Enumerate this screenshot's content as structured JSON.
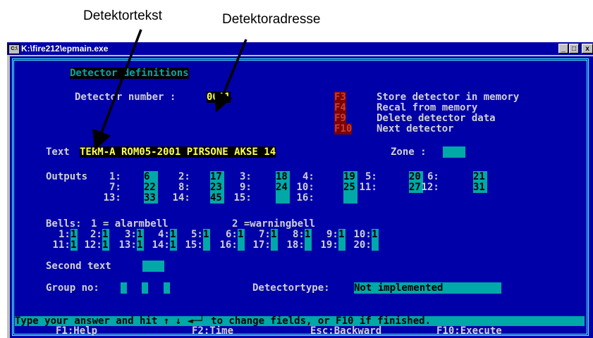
{
  "annotations": {
    "label_left": "Detektortekst",
    "label_right": "Detektoradresse"
  },
  "window": {
    "title": "K:\\fire212\\epmain.exe",
    "icon_text": "C:\\",
    "min_label": "_",
    "max_label": "□",
    "close_label": "x"
  },
  "header": {
    "title": "Detector definitions",
    "number_label": "Detector number :",
    "number_value": "0001"
  },
  "fkeys": [
    {
      "key": "F3",
      "label": "Store detector in memory"
    },
    {
      "key": "F4",
      "label": "Recal from memory"
    },
    {
      "key": "F9",
      "label": "Delete detector data"
    },
    {
      "key": "F10",
      "label": "Next detector"
    }
  ],
  "text_field": {
    "label": "Text",
    "value": "TERM-A ROM05-2001 PIRSONE AKSE 14",
    "zone_label": "Zone :",
    "zone_value": ""
  },
  "outputs": {
    "label": "Outputs",
    "items": [
      {
        "n": "1:",
        "v": "6"
      },
      {
        "n": "2:",
        "v": "17"
      },
      {
        "n": "3:",
        "v": "18"
      },
      {
        "n": "4:",
        "v": "19"
      },
      {
        "n": "5:",
        "v": "20"
      },
      {
        "n": "6:",
        "v": "21"
      },
      {
        "n": "7:",
        "v": "22"
      },
      {
        "n": "8:",
        "v": "23"
      },
      {
        "n": "9:",
        "v": "24"
      },
      {
        "n": "10:",
        "v": "25"
      },
      {
        "n": "11:",
        "v": "27"
      },
      {
        "n": "12:",
        "v": "31"
      },
      {
        "n": "13:",
        "v": "33"
      },
      {
        "n": "14:",
        "v": "45"
      },
      {
        "n": "15:",
        "v": ""
      },
      {
        "n": "16:",
        "v": ""
      }
    ]
  },
  "bells": {
    "label": "Bells:",
    "legend_1": "1 = alarmbell",
    "legend_2": "2 =warningbell",
    "items": [
      {
        "n": "1:",
        "v": "1"
      },
      {
        "n": "2:",
        "v": "1"
      },
      {
        "n": "3:",
        "v": "1"
      },
      {
        "n": "4:",
        "v": "1"
      },
      {
        "n": "5:",
        "v": "1"
      },
      {
        "n": "6:",
        "v": "1"
      },
      {
        "n": "7:",
        "v": "1"
      },
      {
        "n": "8:",
        "v": "1"
      },
      {
        "n": "9:",
        "v": "1"
      },
      {
        "n": "10:",
        "v": "1"
      },
      {
        "n": "11:",
        "v": "1"
      },
      {
        "n": "12:",
        "v": "1"
      },
      {
        "n": "13:",
        "v": "1"
      },
      {
        "n": "14:",
        "v": "1"
      },
      {
        "n": "15:",
        "v": ""
      },
      {
        "n": "16:",
        "v": ""
      },
      {
        "n": "17:",
        "v": ""
      },
      {
        "n": "18:",
        "v": ""
      },
      {
        "n": "19:",
        "v": ""
      },
      {
        "n": "20:",
        "v": ""
      }
    ]
  },
  "second_text": {
    "label": "Second text",
    "value": ""
  },
  "group": {
    "label": "Group no:",
    "values": [
      "",
      "",
      ""
    ]
  },
  "detector_type": {
    "label": "Detectortype:",
    "value": "Not implemented"
  },
  "status": {
    "message": "Type your answer and hit ↑ ↓ ◄─┘ to change fields, or F10 if finished."
  },
  "footer": {
    "f1": "F1:Help",
    "f2": "F2:Time",
    "esc": "Esc:Backward",
    "f10": "F10:Execute"
  }
}
